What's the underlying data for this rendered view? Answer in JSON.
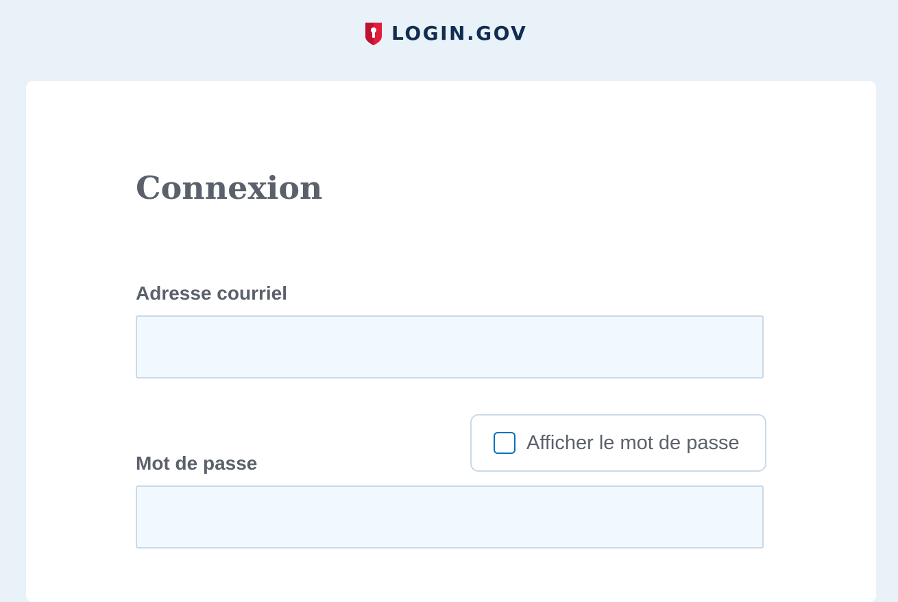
{
  "header": {
    "logo_text": "LOGIN.GOV",
    "logo_icon": "shield-keyhole-icon"
  },
  "form": {
    "title": "Connexion",
    "email_label": "Adresse courriel",
    "email_value": "",
    "password_label": "Mot de passe",
    "password_value": "",
    "show_password_label": "Afficher le mot de passe",
    "show_password_checked": false
  },
  "colors": {
    "page_background": "#e9f1f9",
    "card_background": "#ffffff",
    "brand_navy": "#112e51",
    "brand_red": "#e21c3d",
    "text_gray": "#5b616b",
    "input_background": "#f1f8fe",
    "input_border": "#cad9e8",
    "checkbox_border": "#0071bb"
  }
}
